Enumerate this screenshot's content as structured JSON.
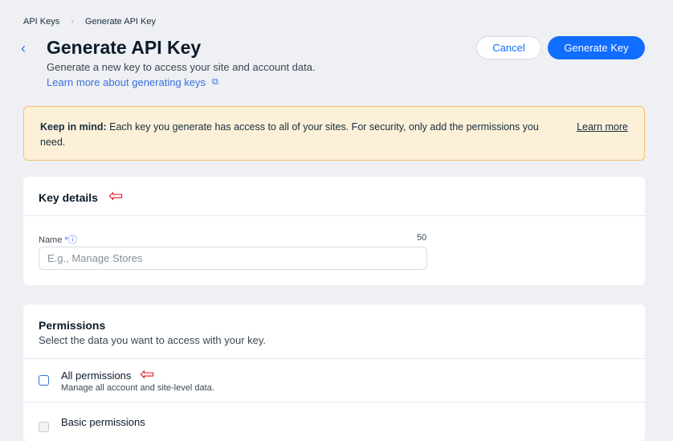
{
  "breadcrumb": [
    "API Keys",
    "Generate API Key"
  ],
  "header": {
    "title": "Generate API Key",
    "subtitle": "Generate a new key to access your site and account data.",
    "learn_link": "Learn more about generating keys",
    "cancel": "Cancel",
    "generate": "Generate Key"
  },
  "notice": {
    "bold": "Keep in mind:",
    "text": " Each key you generate has access to all of your sites. For security, only add the permissions you need.",
    "link": "Learn more"
  },
  "key_details": {
    "title": "Key details",
    "name_label": "Name",
    "required": "*",
    "max": "50",
    "placeholder": "E.g., Manage Stores"
  },
  "permissions": {
    "title": "Permissions",
    "subtitle": "Select the data you want to access with your key.",
    "items": [
      {
        "label": "All permissions",
        "desc": "Manage all account and site-level data."
      },
      {
        "label": "Basic permissions"
      }
    ]
  }
}
